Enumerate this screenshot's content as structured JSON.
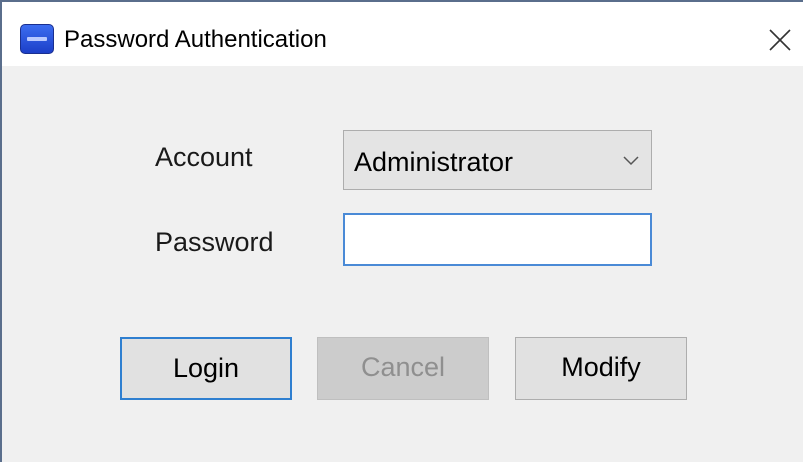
{
  "window": {
    "title": "Password Authentication",
    "icon": "app-icon",
    "close_icon": "close-icon"
  },
  "form": {
    "account_label": "Account",
    "account_value": "Administrator",
    "password_label": "Password",
    "password_value": ""
  },
  "buttons": {
    "login": "Login",
    "cancel": "Cancel",
    "modify": "Modify"
  },
  "colors": {
    "focus_border": "#2f7fd0",
    "input_border": "#4a8ad6",
    "disabled_text": "#8f8f8f"
  }
}
